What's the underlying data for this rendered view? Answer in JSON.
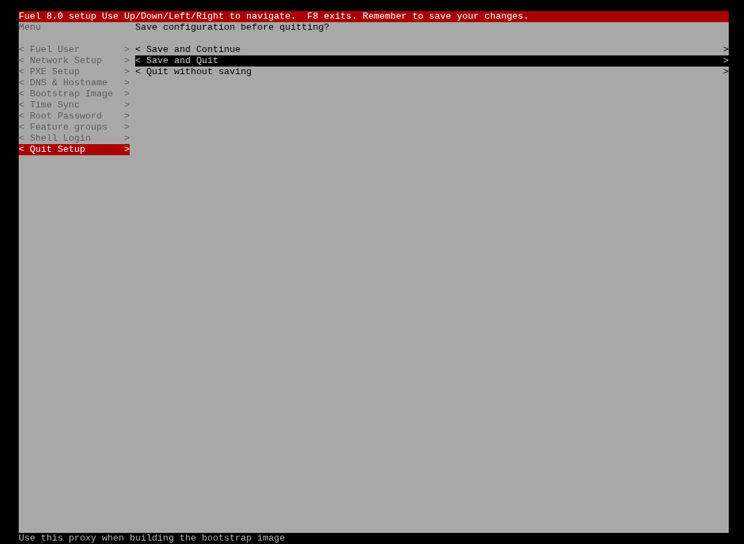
{
  "header": {
    "title": "Fuel 8.0 setup Use Up/Down/Left/Right to navigate.  F8 exits. Remember to save your changes."
  },
  "sidebar": {
    "title": "Menu",
    "items": [
      {
        "prefix": "<",
        "label": "Fuel User",
        "suffix": ">",
        "selected": false
      },
      {
        "prefix": "<",
        "label": "Network Setup",
        "suffix": ">",
        "selected": false
      },
      {
        "prefix": "<",
        "label": "PXE Setup",
        "suffix": ">",
        "selected": false
      },
      {
        "prefix": "<",
        "label": "DNS & Hostname",
        "suffix": ">",
        "selected": false
      },
      {
        "prefix": "<",
        "label": "Bootstrap Image",
        "suffix": ">",
        "selected": false
      },
      {
        "prefix": "<",
        "label": "Time Sync",
        "suffix": ">",
        "selected": false
      },
      {
        "prefix": "<",
        "label": "Root Password",
        "suffix": ">",
        "selected": false
      },
      {
        "prefix": "<",
        "label": "Feature groups",
        "suffix": ">",
        "selected": false
      },
      {
        "prefix": "<",
        "label": "Shell Login",
        "suffix": ">",
        "selected": false
      },
      {
        "prefix": "<",
        "label": "Quit Setup",
        "suffix": ">",
        "selected": true
      }
    ]
  },
  "panel": {
    "question": "Save configuration before quitting?",
    "options": [
      {
        "prefix": "<",
        "label": "Save and Continue",
        "suffix": ">",
        "selected": false
      },
      {
        "prefix": "<",
        "label": "Save and Quit",
        "suffix": ">",
        "selected": true
      },
      {
        "prefix": "<",
        "label": "Quit without saving",
        "suffix": ">",
        "selected": false
      }
    ]
  },
  "status_bar": {
    "text": "Use this proxy when building the bootstrap image"
  }
}
